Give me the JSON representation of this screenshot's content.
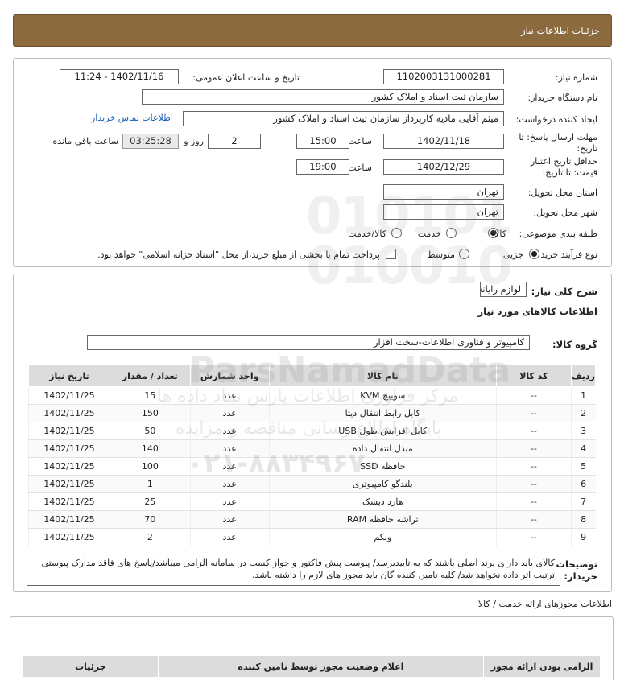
{
  "header": {
    "title": "جزئیات اطلاعات نیاز"
  },
  "form": {
    "need_number_label": "شماره نیاز:",
    "need_number": "1102003131000281",
    "announce_label": "تاریخ و ساعت اعلان عمومی:",
    "announce_value": "1402/11/16 - 11:24",
    "buyer_org_label": "نام دستگاه خریدار:",
    "buyer_org": "سازمان ثبت اسناد و املاک کشور",
    "creator_label": "ایجاد کننده درخواست:",
    "creator": "میثم آقایی مادیه کارپرداز سازمان ثبت اسناد و املاک کشور",
    "contact_link": "اطلاعات تماس خریدار",
    "deadline_label": "مهلت ارسال پاسخ: تا تاریخ:",
    "deadline_date": "1402/11/18",
    "time_label": "ساعت",
    "deadline_time": "15:00",
    "days_value": "2",
    "days_label": "روز و",
    "remaining_time": "03:25:28",
    "remaining_label": "ساعت باقی مانده",
    "validity_label": "حداقل تاریخ اعتبار قیمت: تا تاریخ:",
    "validity_date": "1402/12/29",
    "validity_time_label": "ساعت",
    "validity_time": "19:00",
    "province_label": "استان محل تحویل:",
    "province": "تهران",
    "city_label": "شهر محل تحویل:",
    "city": "تهران",
    "category_label": "طبقه بندی موضوعی:",
    "category_options": [
      "کالا",
      "خدمت",
      "کالا/خدمت"
    ],
    "category_selected": "کالا",
    "process_label": "نوع فرآیند خرید :",
    "process_options": [
      "جزیی",
      "متوسط"
    ],
    "process_selected": "جزیی",
    "payment_note": "پرداخت تمام یا بخشی از مبلغ خرید،از محل \"اسناد خزانه اسلامی\" خواهد بود."
  },
  "summary": {
    "label": "شرح کلی نیاز:",
    "value": "لوازم رایانه",
    "goods_heading": "اطلاعات کالاهای مورد نیاز",
    "group_label": "گروه کالا:",
    "group_value": "کامپیوتر و فناوری اطلاعات-سخت افزار"
  },
  "goods_table": {
    "headers": [
      "ردیف",
      "کد کالا",
      "نام کالا",
      "واحد شمارش",
      "تعداد / مقدار",
      "تاریخ نیاز"
    ],
    "rows": [
      [
        "1",
        "--",
        "سوییچ KVM",
        "عدد",
        "15",
        "1402/11/25"
      ],
      [
        "2",
        "--",
        "کابل رابط انتقال دیتا",
        "عدد",
        "150",
        "1402/11/25"
      ],
      [
        "3",
        "--",
        "کابل افزایش طول USB",
        "عدد",
        "50",
        "1402/11/25"
      ],
      [
        "4",
        "--",
        "مبدل انتقال داده",
        "عدد",
        "140",
        "1402/11/25"
      ],
      [
        "5",
        "--",
        "حافظه SSD",
        "عدد",
        "100",
        "1402/11/25"
      ],
      [
        "6",
        "--",
        "بلندگو کامپیوتری",
        "عدد",
        "1",
        "1402/11/25"
      ],
      [
        "7",
        "--",
        "هارد دیسک",
        "عدد",
        "25",
        "1402/11/25"
      ],
      [
        "8",
        "--",
        "تراشه حافظه RAM",
        "عدد",
        "70",
        "1402/11/25"
      ],
      [
        "9",
        "--",
        "وبکم",
        "عدد",
        "2",
        "1402/11/25"
      ]
    ]
  },
  "notes": {
    "label": "توضیحات خریدار:",
    "text": "کالای باید دارای برند اصلی باشند که به تاییدبرسد/ پیوست پیش فاکتور و جواز کسب در سامانه الزامی میباشد/پاسخ های فاقد مدارک پیوستی ترتیب اثر داده نخواهد شد/ کلیه تامین کننده گان باید مجوز های لازم را داشته باشد."
  },
  "licenses": {
    "heading": "اطلاعات مجوزهای ارائه خدمت / کالا",
    "headers": [
      "الزامی بودن ارائه مجوز",
      "اعلام وضعیت مجوز توسط تامین کننده",
      "جزئیات"
    ]
  },
  "watermark": {
    "brand": "ParsNamadData",
    "line1": "مرکز فراوری اطلاعات پارس نماد داده ها",
    "line2": "پایگاه اطلاع رسانی مناقصه و مزایده",
    "phone": "۰۲۱-۸۸۳۴۹۶۷۰"
  },
  "colors": {
    "header_bg": "#8b6a3e",
    "link": "#1a5fb4",
    "table_header_bg": "#dcdcdc"
  }
}
